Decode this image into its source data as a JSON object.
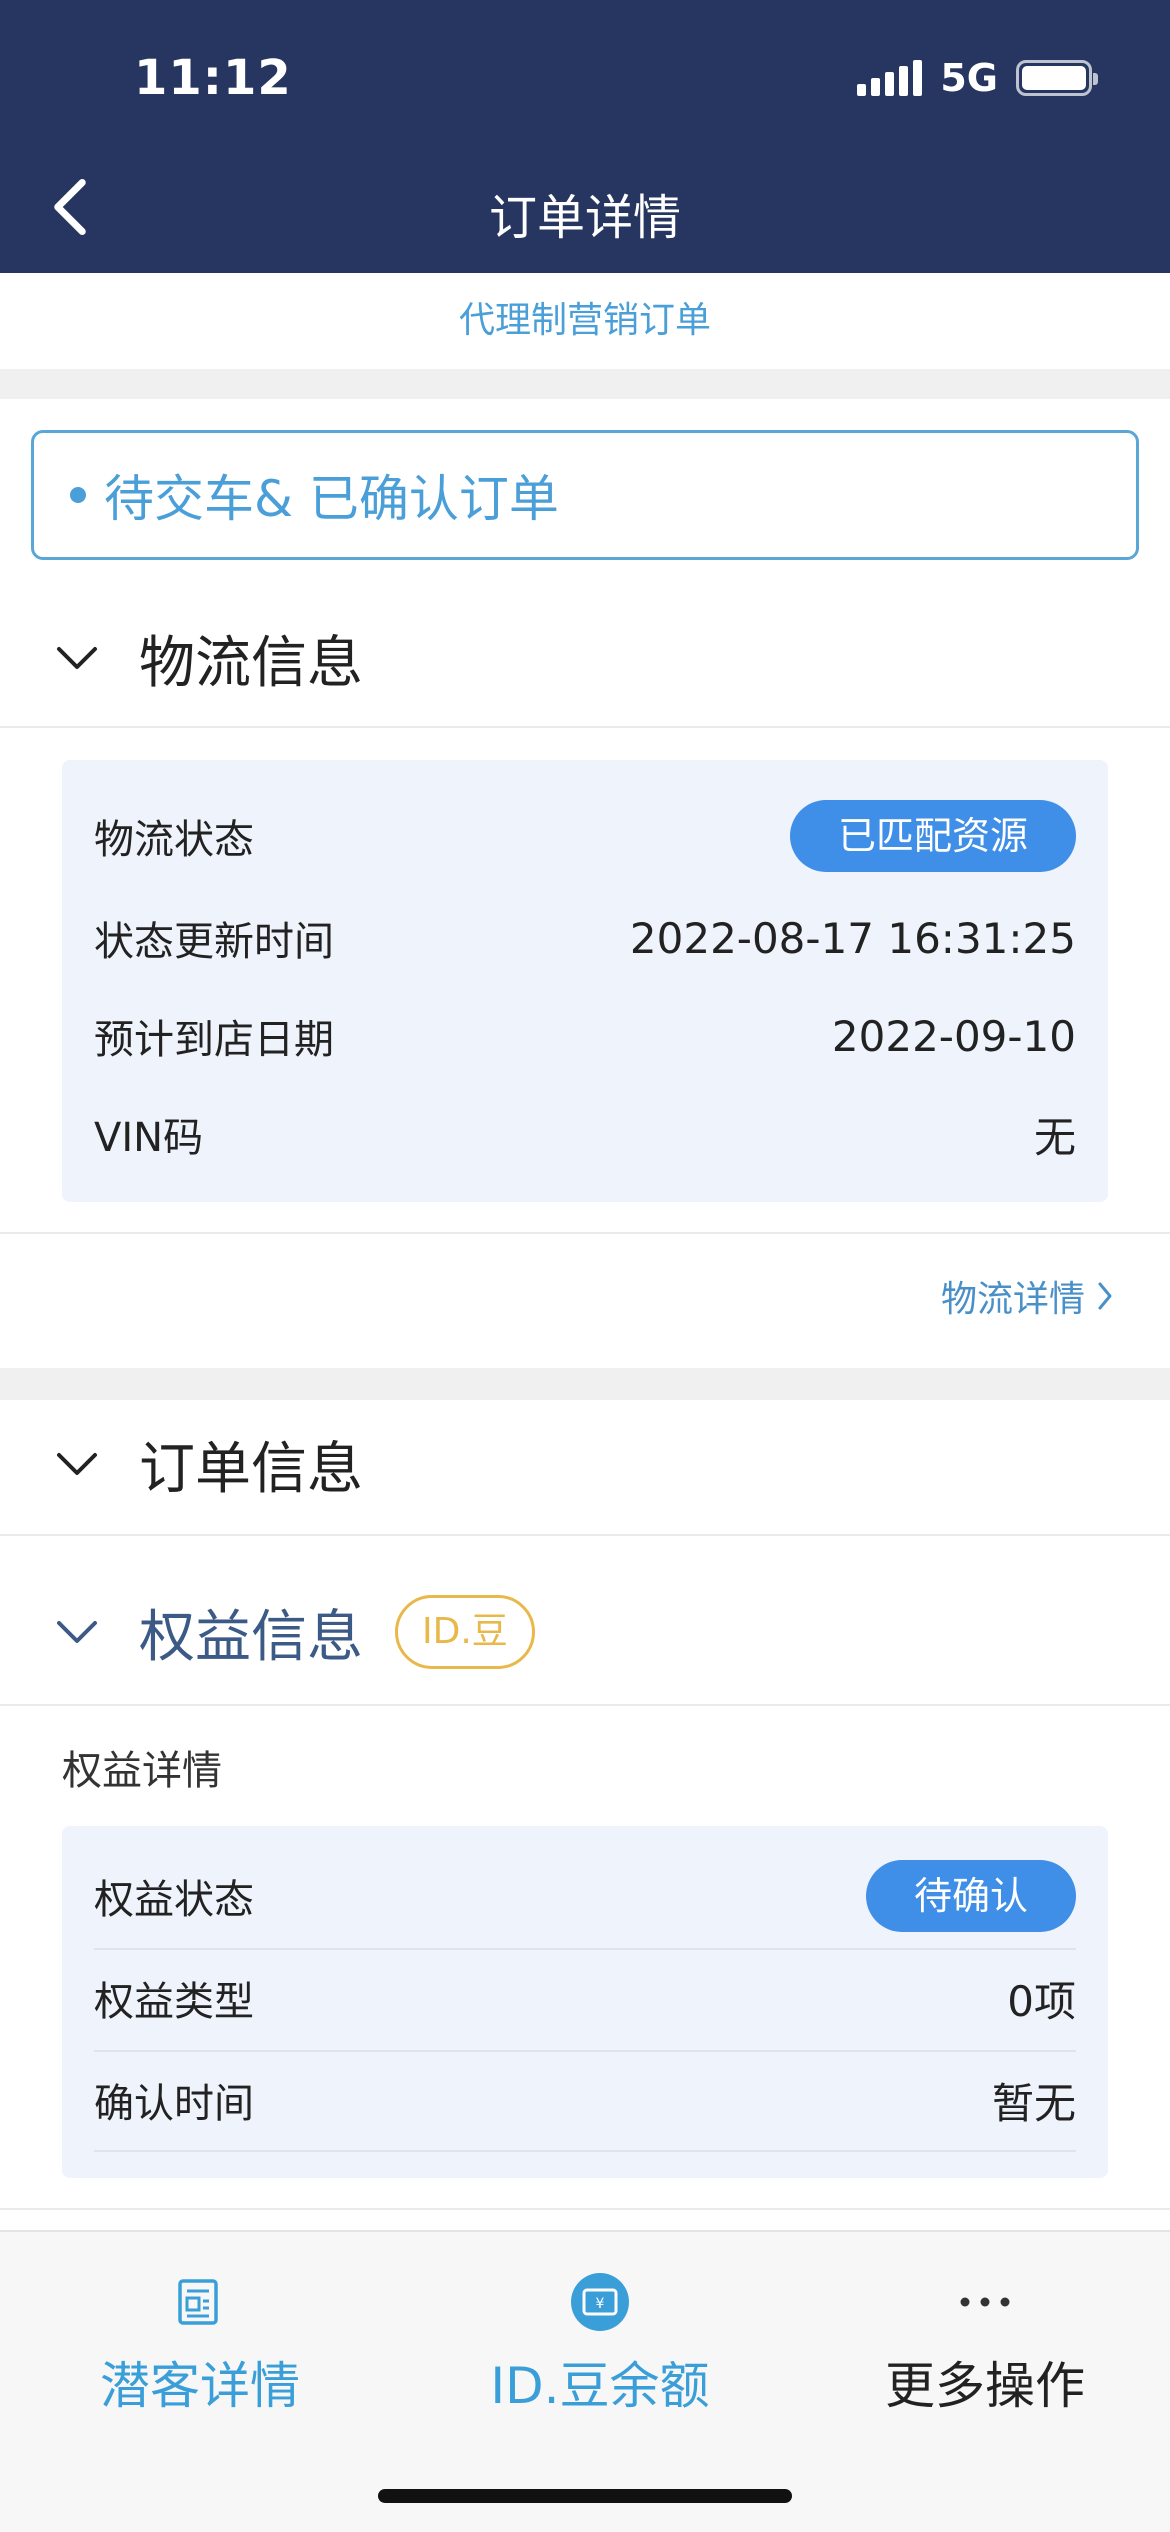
{
  "status_bar": {
    "time": "11:12",
    "network": "5G"
  },
  "nav": {
    "title": "订单详情"
  },
  "subtitle": "代理制营销订单",
  "order_status": "待交车& 已确认订单",
  "logistics": {
    "section_title": "物流信息",
    "rows": [
      {
        "label": "物流状态",
        "value": "已匹配资源"
      },
      {
        "label": "状态更新时间",
        "value": "2022-08-17 16:31:25"
      },
      {
        "label": "预计到店日期",
        "value": "2022-09-10"
      },
      {
        "label": "VIN码",
        "value": "无"
      }
    ],
    "detail_link": "物流详情"
  },
  "order_info": {
    "section_title": "订单信息"
  },
  "benefits": {
    "section_title": "权益信息",
    "badge": "ID.豆",
    "sub_title": "权益详情",
    "rows": [
      {
        "label": "权益状态",
        "value": "待确认"
      },
      {
        "label": "权益类型",
        "value": "0项"
      },
      {
        "label": "确认时间",
        "value": "暂无"
      }
    ]
  },
  "bottom_tabs": [
    {
      "label": "潜客详情",
      "icon": "document-icon"
    },
    {
      "label": "ID.豆余额",
      "icon": "coupon-icon"
    },
    {
      "label": "更多操作",
      "icon": "more-icon"
    }
  ],
  "colors": {
    "header_bg": "#273661",
    "accent_blue": "#4a9fd8",
    "pill_blue": "#3f8ee7",
    "badge_gold": "#e8b84a",
    "card_bg": "#eef3fc"
  }
}
